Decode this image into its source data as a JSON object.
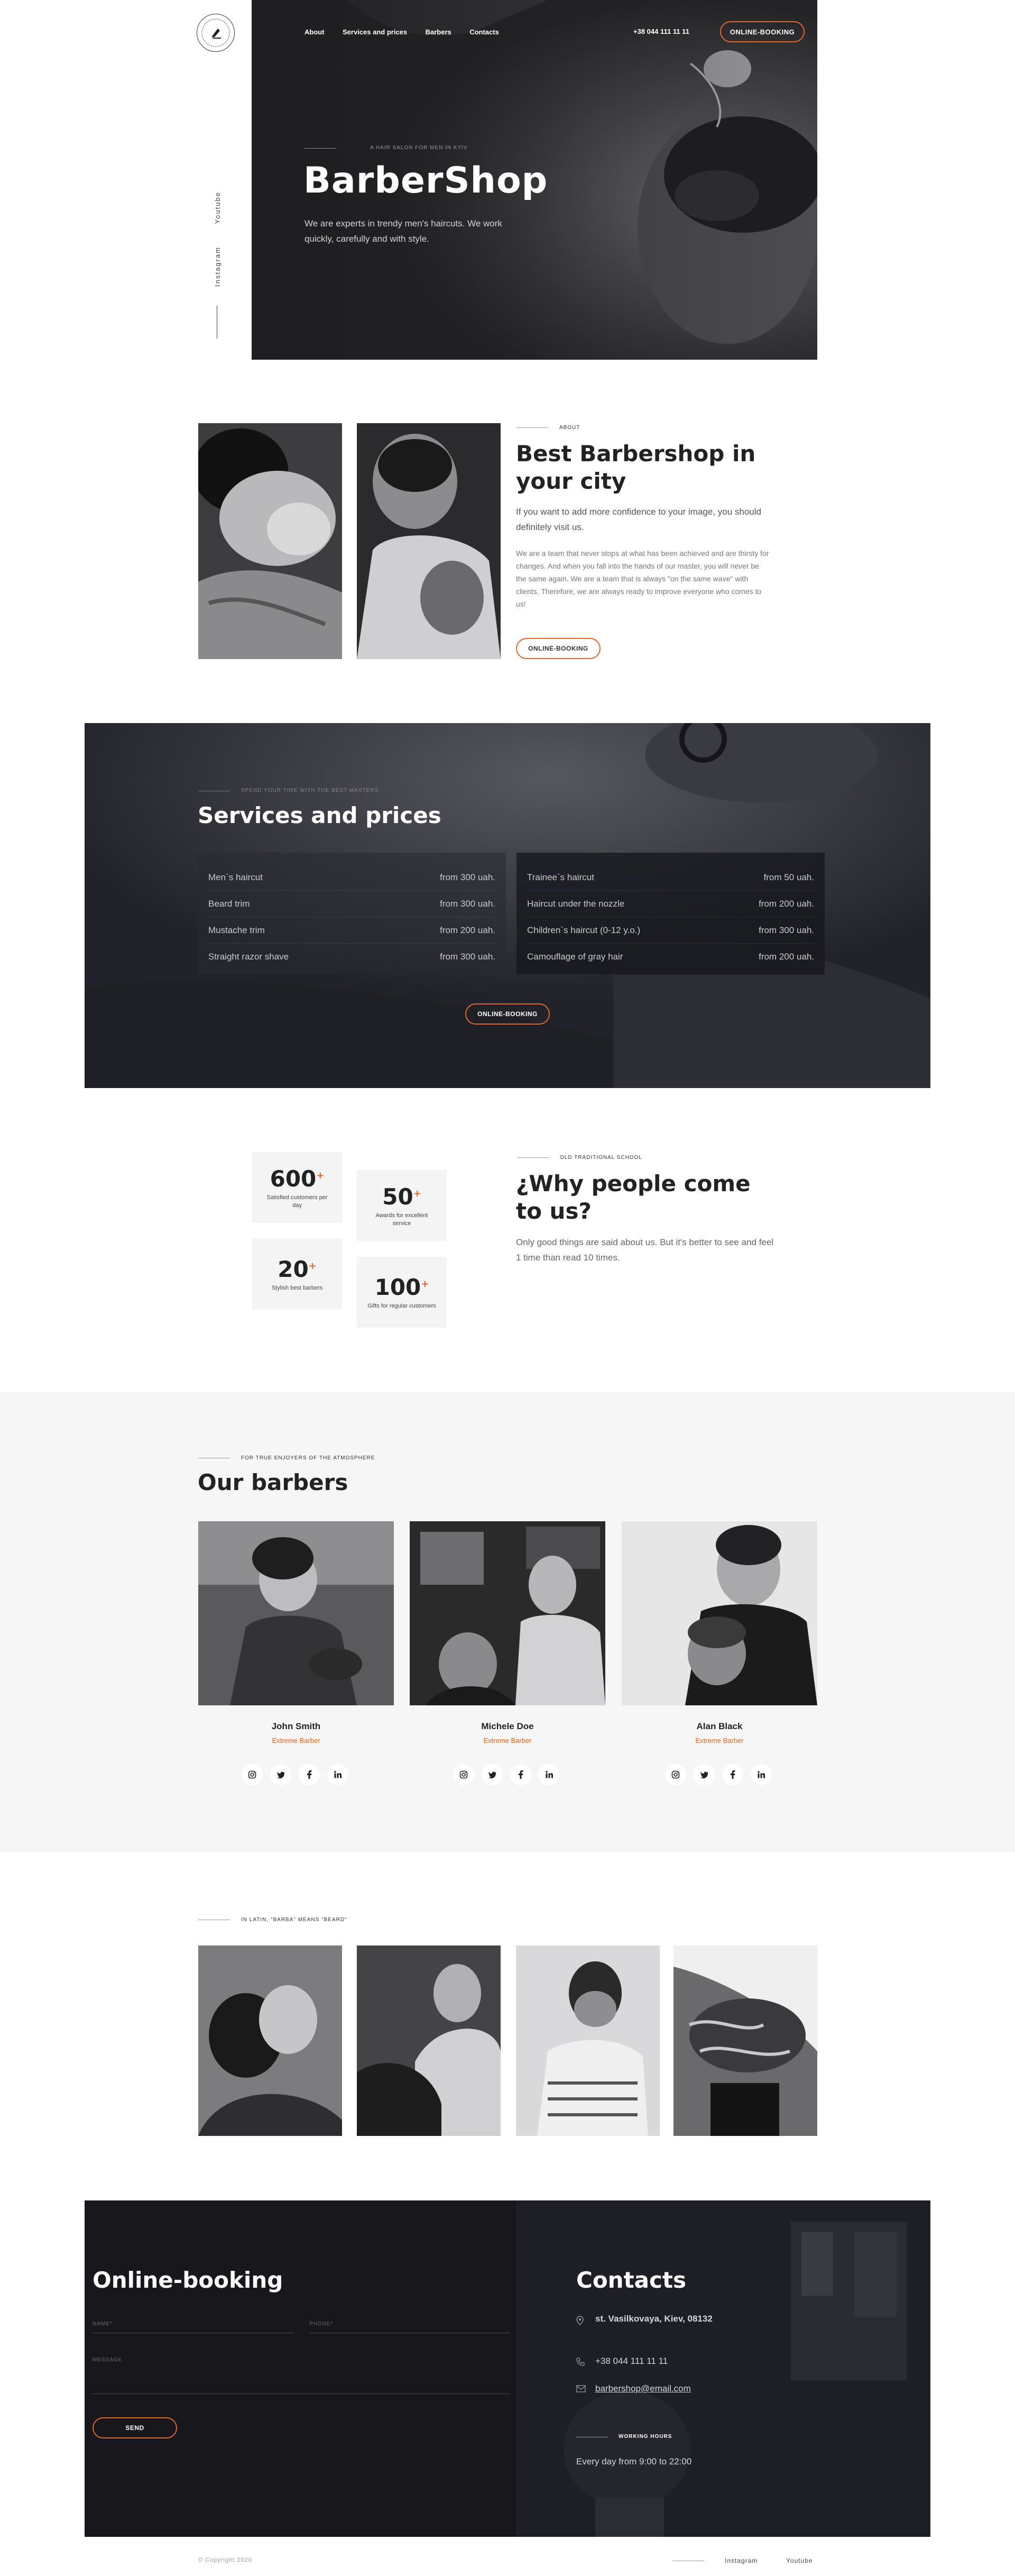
{
  "header": {
    "nav": [
      "About",
      "Services and prices",
      "Barbers",
      "Contacts"
    ],
    "phone": "+38 044 111 11 11",
    "booking_label": "ONLINE-BOOKING",
    "side_links": [
      "Youtube",
      "Instagram"
    ]
  },
  "hero": {
    "eyebrow": "A HAIR SALON FOR MEN IN KYIV",
    "title": "BarberShop",
    "subtitle": "We are experts in trendy men's haircuts. We work quickly, carefully and with style."
  },
  "about": {
    "eyebrow": "ABOUT",
    "title": "Best Barbershop in your city",
    "lead": "If you want to add more confidence to your image, you should definitely visit us.",
    "body": "We are a team that never stops at what has been achieved and are thirsty for changes. And when you fall into the hands of our master, you will never be the same again. We are a team that is always \"on the same wave\" with clients. Therefore, we are always ready to improve everyone who comes to us!",
    "button": "ONLINE-BOOKING"
  },
  "services": {
    "eyebrow": "SPEND YOUR TIME WITH THE BEST MASTERS",
    "title": "Services and prices",
    "left": [
      {
        "name": "Men`s haircut",
        "price": "from 300 uah."
      },
      {
        "name": "Beard trim",
        "price": "from 300 uah."
      },
      {
        "name": "Mustache trim",
        "price": "from 200 uah."
      },
      {
        "name": "Straight razor shave",
        "price": "from 300 uah."
      }
    ],
    "right": [
      {
        "name": "Trainee`s haircut",
        "price": "from 50 uah."
      },
      {
        "name": "Haircut under the nozzle",
        "price": "from 200 uah."
      },
      {
        "name": "Children`s haircut (0-12 y.o.)",
        "price": "from 300 uah."
      },
      {
        "name": "Camouflage of gray hair",
        "price": "from 200 uah."
      }
    ],
    "button": "ONLINE-BOOKING"
  },
  "stats": {
    "items": [
      {
        "num": "600",
        "label": "Satisfied customers per day"
      },
      {
        "num": "50",
        "label": "Awards for excellent service"
      },
      {
        "num": "20",
        "label": "Stylish best barbers"
      },
      {
        "num": "100",
        "label": "Gifts for regular customers"
      }
    ],
    "plus": "+",
    "eyebrow": "OLD TRADITIONAL SCHOOL",
    "title": "¿Why people come to us?",
    "text": "Only good things are said about us. But it's better to see and feel 1 time than read 10 times."
  },
  "barbers": {
    "eyebrow": "FOR TRUE ENJOYERS OF THE ATMOSPHERE",
    "title": "Our barbers",
    "people": [
      {
        "name": "John Smith",
        "role": "Extreme Barber"
      },
      {
        "name": "Michele Doe",
        "role": "Extreme Barber"
      },
      {
        "name": "Alan Black",
        "role": "Extreme Barber"
      }
    ],
    "social_icons": [
      "instagram-icon",
      "twitter-icon",
      "facebook-icon",
      "linkedin-icon"
    ]
  },
  "gallery": {
    "eyebrow": "IN LATIN, \"BARBA\" MEANS \"BEARD\""
  },
  "booking": {
    "title": "Online-booking",
    "name_label": "NAME*",
    "phone_label": "PHONE*",
    "message_label": "MESSAGE",
    "send": "SEND"
  },
  "contacts": {
    "title": "Contacts",
    "address": "st. Vasilkovaya, Kiev, 08132",
    "phone": "+38 044 111 11 11",
    "email": "barbershop@email.com",
    "hours_label": "WORKING HOURS",
    "hours": "Every day from 9:00 to 22:00"
  },
  "footer": {
    "copyright": "© Copyright 2020",
    "links": [
      "Instagram",
      "Youtube"
    ]
  },
  "colors": {
    "accent": "#e0672a",
    "dark": "#17171c"
  }
}
